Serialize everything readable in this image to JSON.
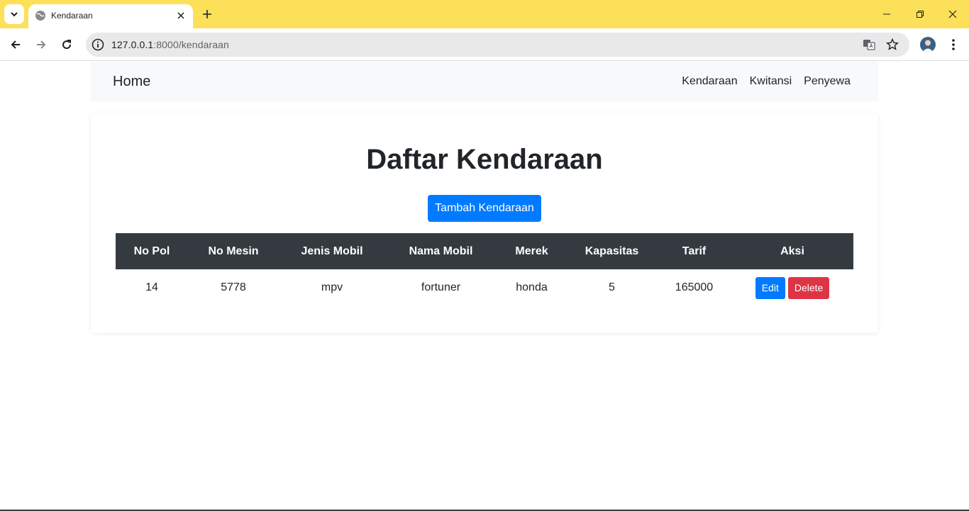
{
  "browser": {
    "tab_title": "Kendaraan",
    "url_host": "127.0.0.1",
    "url_path": ":8000/kendaraan",
    "accent_color": "#fde05a"
  },
  "navbar": {
    "brand": "Home",
    "links": [
      "Kendaraan",
      "Kwitansi",
      "Penyewa"
    ]
  },
  "main": {
    "heading": "Daftar Kendaraan",
    "add_button": "Tambah Kendaraan",
    "table": {
      "headers": [
        "No Pol",
        "No Mesin",
        "Jenis Mobil",
        "Nama Mobil",
        "Merek",
        "Kapasitas",
        "Tarif",
        "Aksi"
      ],
      "rows": [
        {
          "cells": [
            "14",
            "5778",
            "mpv",
            "fortuner",
            "honda",
            "5",
            "165000"
          ],
          "edit_label": "Edit",
          "delete_label": "Delete"
        }
      ]
    }
  },
  "colors": {
    "primary": "#007bff",
    "danger": "#dc3545",
    "table_header": "#343a40"
  }
}
